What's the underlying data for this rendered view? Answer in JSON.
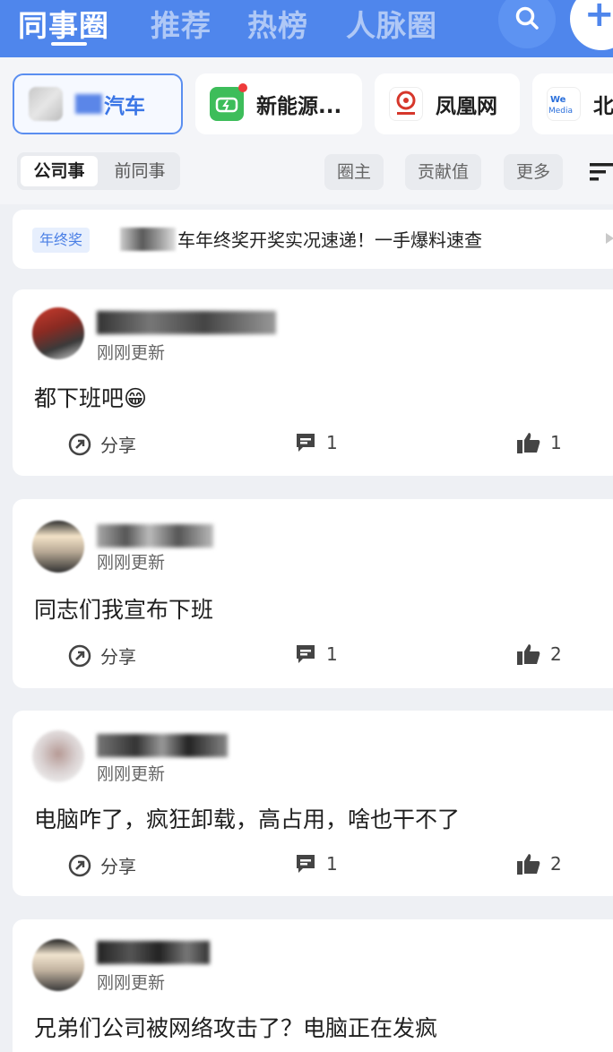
{
  "top_tabs": [
    "同事圈",
    "推荐",
    "热榜",
    "人脉圈"
  ],
  "circles": [
    {
      "name": "汽车",
      "selected": true
    },
    {
      "name": "新能源...",
      "selected": false
    },
    {
      "name": "凤凰网",
      "selected": false
    },
    {
      "name": "北",
      "selected": false
    }
  ],
  "filters": {
    "seg_active": "公司事",
    "seg_inactive": "前同事",
    "buttons": [
      "圈主",
      "贡献值",
      "更多"
    ]
  },
  "banner": {
    "tag": "年终奖",
    "text": "车年终奖开奖实况速递！一手爆料速查"
  },
  "posts": [
    {
      "time": "刚刚更新",
      "content": "都下班吧",
      "emoji": "😁",
      "share_label": "分享",
      "comments": "1",
      "likes": "1"
    },
    {
      "time": "刚刚更新",
      "content": "同志们我宣布下班",
      "share_label": "分享",
      "comments": "1",
      "likes": "2"
    },
    {
      "time": "刚刚更新",
      "content": "电脑咋了，疯狂卸载，高占用，啥也干不了",
      "share_label": "分享",
      "comments": "1",
      "likes": "2"
    },
    {
      "time": "刚刚更新",
      "content": "兄弟们公司被网络攻击了？电脑正在发疯"
    }
  ],
  "colors": {
    "brand_blue": "#4f86ec",
    "tag_blue": "#4a7fe5"
  }
}
